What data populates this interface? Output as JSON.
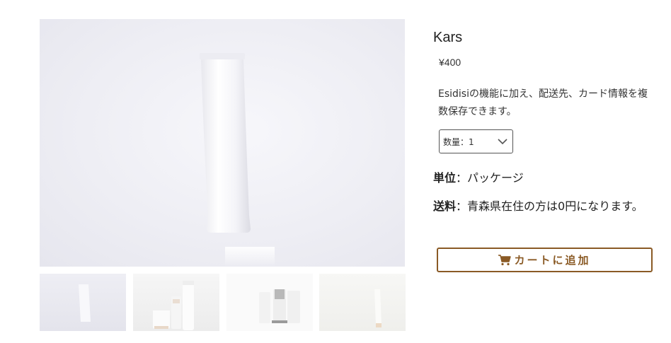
{
  "product": {
    "name": "Kars",
    "price": "¥400",
    "description": "Esidisiの機能に加え、配送先、カード情報を複数保存できます。",
    "quantity_label": "数量：1",
    "unit_label": "単位",
    "unit_value": "：パッケージ",
    "shipping_label": "送料",
    "shipping_value": "：青森県在住の方は0円になります。",
    "add_to_cart": "カートに追加"
  },
  "colors": {
    "accent": "#8a5a25"
  },
  "icons": {
    "cart": "cart-icon",
    "dropdown": "chevron-down-icon"
  }
}
